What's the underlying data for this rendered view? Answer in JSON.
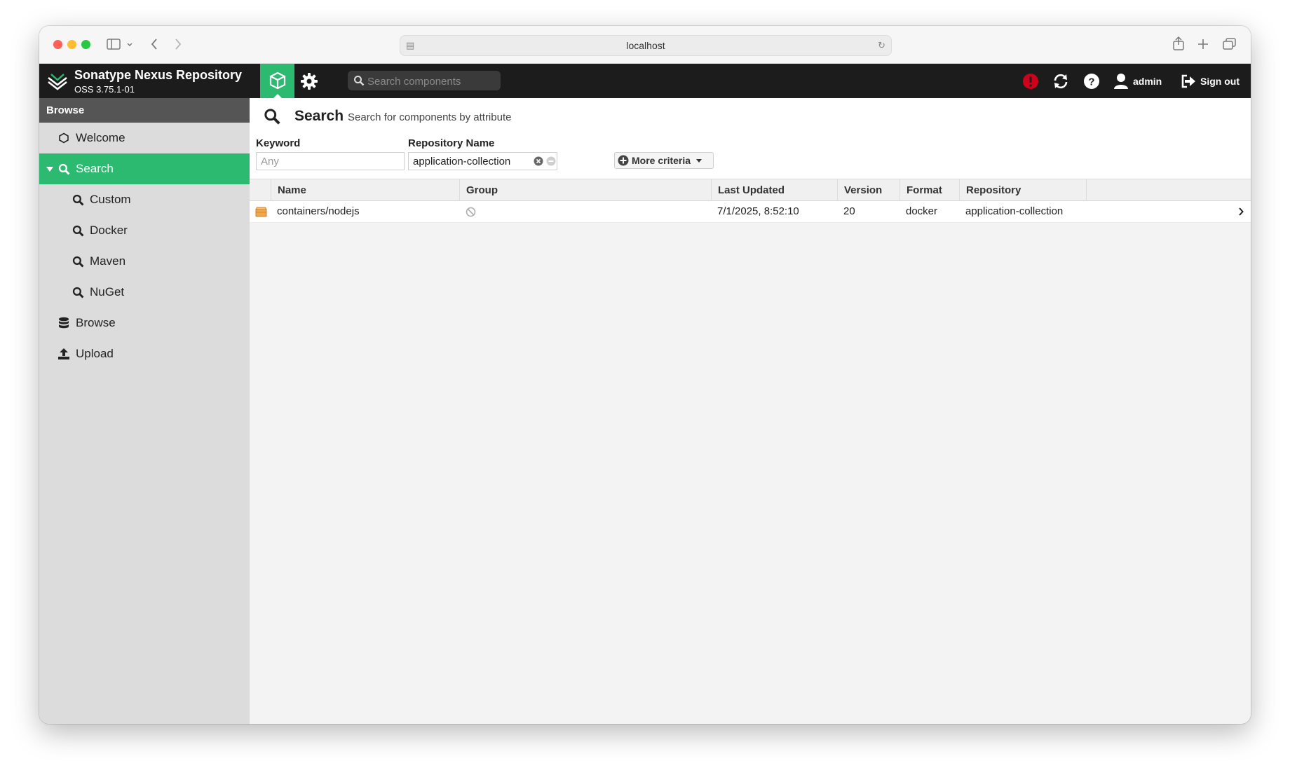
{
  "browser": {
    "address": "localhost"
  },
  "header": {
    "brand_title": "Sonatype Nexus Repository",
    "brand_version": "OSS 3.75.1-01",
    "search_placeholder": "Search components",
    "user_label": "admin",
    "signout_label": "Sign out",
    "accent_color": "#2cba71",
    "alert_color": "#d0021b"
  },
  "sidebar": {
    "heading": "Browse",
    "items": [
      {
        "label": "Welcome",
        "icon": "hexagon-icon"
      },
      {
        "label": "Search",
        "icon": "search-icon",
        "active": true,
        "expanded": true
      },
      {
        "label": "Custom",
        "icon": "search-icon"
      },
      {
        "label": "Docker",
        "icon": "search-icon"
      },
      {
        "label": "Maven",
        "icon": "search-icon"
      },
      {
        "label": "NuGet",
        "icon": "search-icon"
      },
      {
        "label": "Browse",
        "icon": "database-icon"
      },
      {
        "label": "Upload",
        "icon": "upload-icon"
      }
    ]
  },
  "main": {
    "title": "Search",
    "subtitle": "Search for components by attribute",
    "keyword_label": "Keyword",
    "keyword_placeholder": "Any",
    "repo_label": "Repository Name",
    "repo_value": "application-collection",
    "more_criteria_label": "More criteria"
  },
  "grid": {
    "columns": [
      "Name",
      "Group",
      "Last Updated",
      "Version",
      "Format",
      "Repository"
    ],
    "rows": [
      {
        "name": "containers/nodejs",
        "group": "",
        "last_updated": "7/1/2025, 8:52:10",
        "version": "20",
        "format": "docker",
        "repository": "application-collection"
      }
    ]
  }
}
